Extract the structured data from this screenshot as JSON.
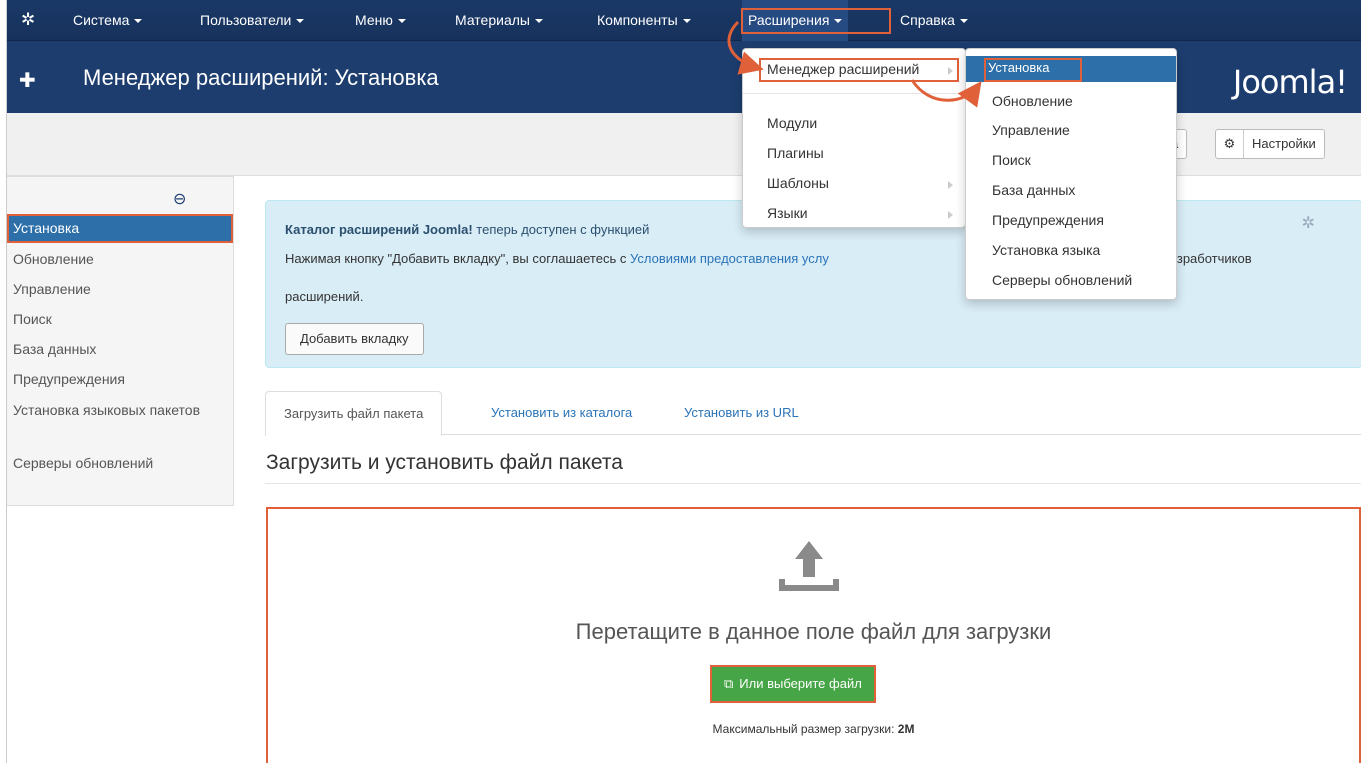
{
  "navbar": {
    "logo_icon": "joomla-icon",
    "items": [
      {
        "label": "Система"
      },
      {
        "label": "Пользователи"
      },
      {
        "label": "Меню"
      },
      {
        "label": "Материалы"
      },
      {
        "label": "Компоненты"
      },
      {
        "label": "Расширения"
      },
      {
        "label": "Справка"
      }
    ]
  },
  "header": {
    "title": "Менеджер расширений: Установка",
    "logo_text": "Joomla!"
  },
  "toolbar": {
    "help_label": "ка",
    "options_label": "Настройки"
  },
  "sidebar": {
    "items": [
      {
        "label": "Установка"
      },
      {
        "label": "Обновление"
      },
      {
        "label": "Управление"
      },
      {
        "label": "Поиск"
      },
      {
        "label": "База данных"
      },
      {
        "label": "Предупреждения"
      },
      {
        "label": "Установка языковых пакетов"
      },
      {
        "label": "Серверы обновлений"
      }
    ]
  },
  "alert": {
    "catalog_bold": "Каталог расширений Joomla!",
    "catalog_rest": " теперь доступен с функцией",
    "agree_text": "Нажимая кнопку \"Добавить вкладку\", вы соглашаетесь с ",
    "terms_link": "Условиями предоставления услу",
    "agree_tail": "них разработчиков",
    "agree_line3": "расширений.",
    "add_tab_button": "Добавить вкладку"
  },
  "tabs": [
    {
      "label": "Загрузить файл пакета"
    },
    {
      "label": "Установить из каталога"
    },
    {
      "label": "Установить из URL"
    }
  ],
  "section_title": "Загрузить и установить файл пакета",
  "upload": {
    "drop_text": "Перетащите в данное поле файл для загрузки",
    "choose_button": "Или выберите файл",
    "max_size_label": "Максимальный размер загрузки:",
    "max_size_value": "2M"
  },
  "extensions_menu": {
    "items": [
      {
        "label": "Менеджер расширений"
      },
      {
        "label": "Модули"
      },
      {
        "label": "Плагины"
      },
      {
        "label": "Шаблоны"
      },
      {
        "label": "Языки"
      }
    ]
  },
  "manager_submenu": {
    "items": [
      {
        "label": "Установка"
      },
      {
        "label": "Обновление"
      },
      {
        "label": "Управление"
      },
      {
        "label": "Поиск"
      },
      {
        "label": "База данных"
      },
      {
        "label": "Предупреждения"
      },
      {
        "label": "Установка языка"
      },
      {
        "label": "Серверы обновлений"
      }
    ]
  },
  "colors": {
    "navbar": "#17325c",
    "highlight": "#e0603a",
    "active": "#2d6fa8",
    "success": "#46a546"
  }
}
